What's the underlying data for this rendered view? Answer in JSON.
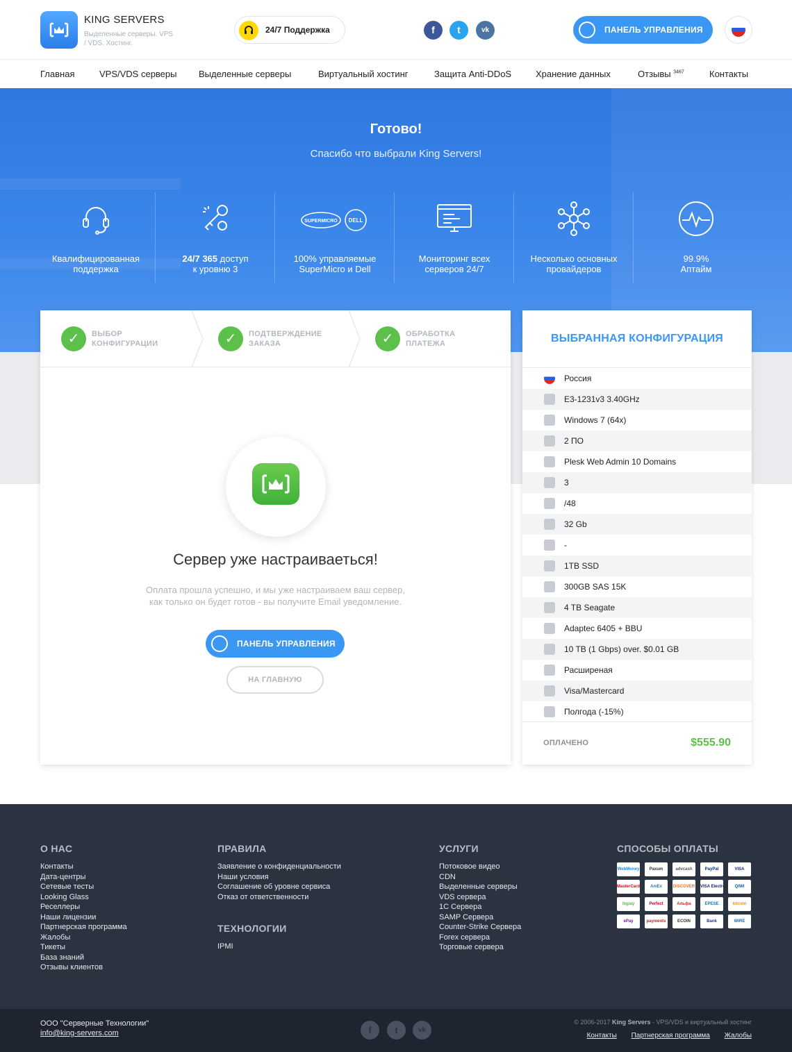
{
  "header": {
    "brand": "KING SERVERS",
    "tagline": "Выделенные серверы. VPS / VDS. Хостинг.",
    "support_label": "24/7 Поддержка",
    "social": [
      "f",
      "t",
      "vk"
    ],
    "panel_button": "ПАНЕЛЬ УПРАВЛЕНИЯ"
  },
  "nav": {
    "items": [
      "Главная",
      "VPS/VDS серверы",
      "Выделенные серверы",
      "Виртуальный хостинг",
      "Защита Anti-DDoS",
      "Хранение данных",
      "Отзывы",
      "Контакты"
    ],
    "reviews_count": "3467"
  },
  "hero": {
    "title": "Готово!",
    "subtitle": "Спасибо что выбрали King Servers!",
    "features": [
      {
        "icon": "headset-icon",
        "line1": "Квалифицированная",
        "line2": "поддержка"
      },
      {
        "icon": "keys-icon",
        "line1_bold": "24/7 365",
        "line1": " доступ",
        "line2": "к уровню 3"
      },
      {
        "icon": "supermicro-dell-logo",
        "line1": "100% управляемые",
        "line2": "SuperMicro и Dell",
        "logo1": "SUPERMICRO",
        "logo2": "DELL"
      },
      {
        "icon": "monitor-icon",
        "line1": "Мониторинг всех",
        "line2": "серверов 24/7"
      },
      {
        "icon": "network-icon",
        "line1": "Несколько основных",
        "line2": "провайдеров"
      },
      {
        "icon": "uptime-icon",
        "line1": "99.9%",
        "line2": "Аптайм"
      }
    ]
  },
  "steps": [
    {
      "line1": "ВЫБОР",
      "line2": "КОНФИГУРАЦИИ"
    },
    {
      "line1": "ПОДТВЕРЖДЕНИЕ",
      "line2": "ЗАКАЗА"
    },
    {
      "line1": "ОБРАБОТКА",
      "line2": "ПЛАТЕЖА"
    }
  ],
  "main": {
    "title": "Сервер уже настраиваеться!",
    "text_line1": "Оплата прошла успешно, и мы уже настраиваем ваш сервер,",
    "text_line2": "как только он будет готов - вы получите Email уведомление.",
    "panel_button": "ПАНЕЛЬ УПРАВЛЕНИЯ",
    "home_button": "НА ГЛАВНУЮ"
  },
  "config": {
    "title": "ВЫБРАННАЯ КОНФИГУРАЦИЯ",
    "rows": [
      {
        "icon": "flag-icon",
        "text": "Россия"
      },
      {
        "icon": "cpu-icon",
        "text": "E3-1231v3 3.40GHz"
      },
      {
        "icon": "os-icon",
        "text": "Windows 7 (64x)"
      },
      {
        "icon": "software-icon",
        "text": "2 ПО"
      },
      {
        "icon": "panel-icon",
        "text": "Plesk Web Admin 10 Domains"
      },
      {
        "icon": "ip-icon",
        "text": "3"
      },
      {
        "icon": "ip-icon",
        "text": "/48"
      },
      {
        "icon": "ram-icon",
        "text": "32 Gb"
      },
      {
        "icon": "raid-icon",
        "text": "-"
      },
      {
        "icon": "disk-icon",
        "text": "1TB SSD"
      },
      {
        "icon": "disk-icon",
        "text": "300GB SAS 15K"
      },
      {
        "icon": "disk-icon",
        "text": "4 TB Seagate"
      },
      {
        "icon": "controller-icon",
        "text": "Adaptec 6405 + BBU"
      },
      {
        "icon": "traffic-icon",
        "text": "10 TB (1 Gbps) over. $0.01 GB"
      },
      {
        "icon": "support-icon",
        "text": "Расширеная"
      },
      {
        "icon": "card-icon",
        "text": "Visa/Mastercard"
      },
      {
        "icon": "calendar-icon",
        "text": "Полгода (-15%)"
      }
    ],
    "paid_label": "ОПЛАЧЕНО",
    "price": "$555.90"
  },
  "footer": {
    "about_title": "О НАС",
    "about": [
      "Контакты",
      "Дата-центры",
      "Сетевые тесты",
      "Looking Glass",
      "Реселлеры",
      "Наши лицензии",
      "Партнерская программа",
      "Жалобы",
      "Тикеты",
      "База знаний",
      "Отзывы клиентов"
    ],
    "rules_title": "ПРАВИЛА",
    "rules": [
      "Заявление о конфиденциальности",
      "Наши условия",
      "Соглашение об уровне сервиса",
      "Отказ от ответственности"
    ],
    "tech_title": "ТЕХНОЛОГИИ",
    "tech": [
      "IPMI"
    ],
    "services_title": "УСЛУГИ",
    "services": [
      "Потоковое видео",
      "CDN",
      "Выделенные серверы",
      "VDS сервера",
      "1С Сервера",
      "SAMP Сервера",
      "Counter-Strike Сервера",
      "Forex сервера",
      "Торговые сервера"
    ],
    "pay_title": "СПОСОБЫ ОПЛАТЫ",
    "pay_methods": [
      "WebMoney",
      "Paxum",
      "advcash",
      "PayPal",
      "VISA",
      "MasterCard",
      "AmEx",
      "DISCOVER",
      "VISA Electron",
      "QIWI",
      "liqpay",
      "Perfect",
      "Альфа",
      "EPESE",
      "bitcoin",
      "ePay",
      "payments",
      "ECOIN",
      "Bank",
      "WIRE"
    ],
    "company": "ООО \"Серверные Технологии\"",
    "email": "info@king-servers.com",
    "copyright_pre": "© 2006-2017 ",
    "copyright_brand": "King Servers",
    "copyright_post": " - VPS/VDS и виртуальный хостинг",
    "bottom_links": [
      "Контакты",
      "Партнерская программа",
      "Жалобы"
    ]
  },
  "colors": {
    "accent": "#3a97f3",
    "success": "#5cc04a",
    "footer": "#2c3340"
  }
}
